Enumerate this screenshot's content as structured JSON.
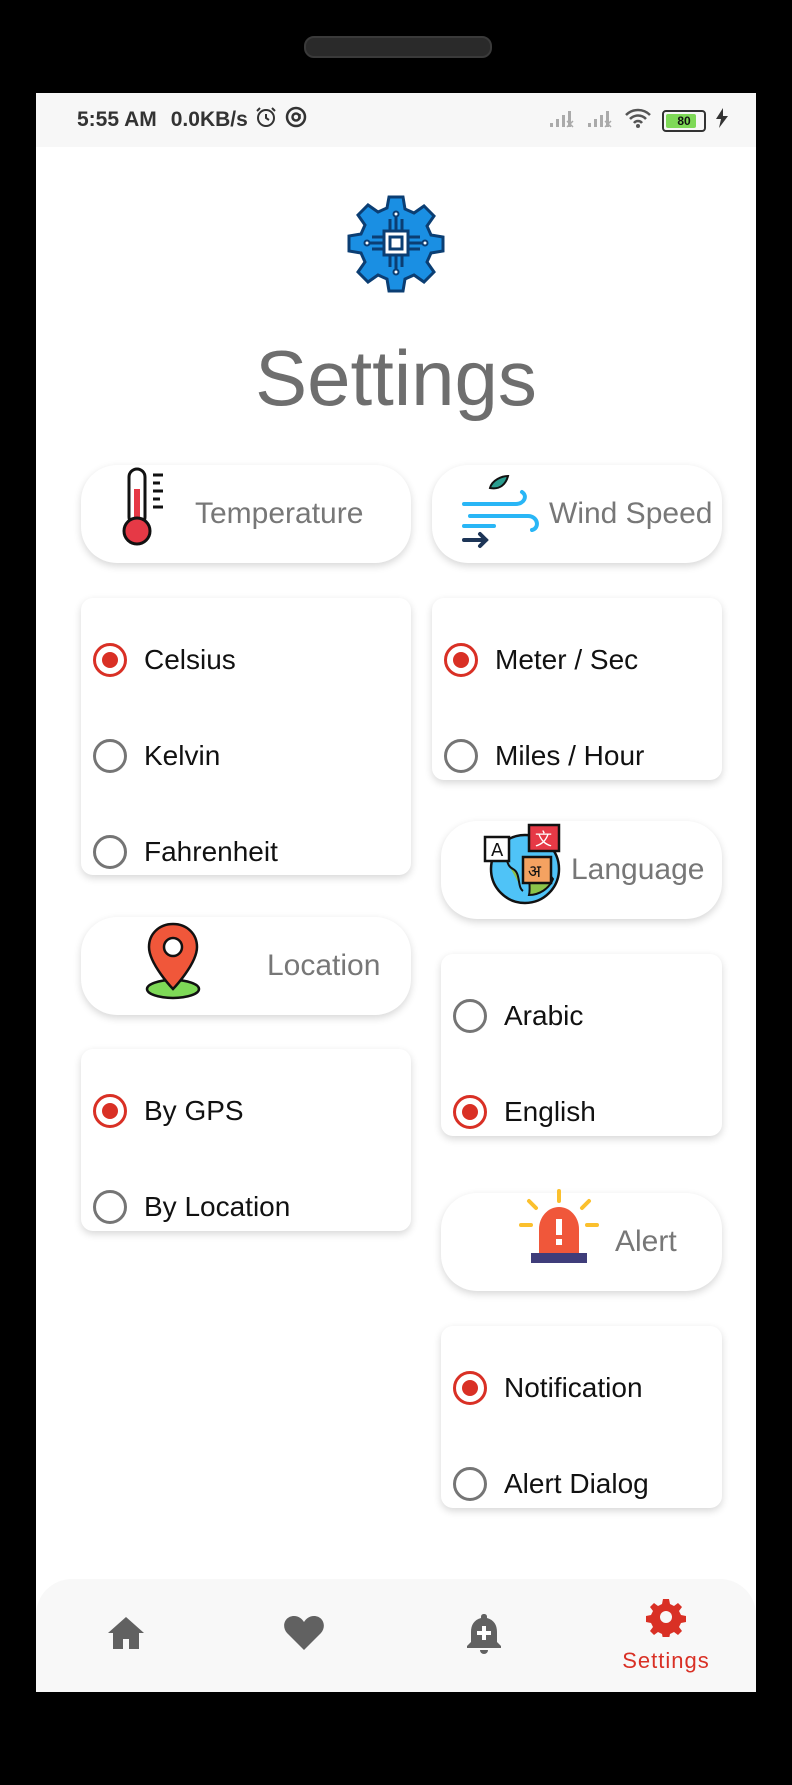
{
  "status_bar": {
    "time": "5:55 AM",
    "speed": "0.0KB/s",
    "battery": "80",
    "icons": [
      "alarm-icon",
      "at-sign-icon",
      "signal-icon",
      "signal-icon",
      "wifi-icon",
      "battery-icon",
      "charging-icon"
    ]
  },
  "page": {
    "title": "Settings",
    "logo_icon": "gear-chip-icon"
  },
  "sections": {
    "temperature": {
      "label": "Temperature",
      "icon": "thermometer-icon",
      "options": [
        "Celsius",
        "Kelvin",
        "Fahrenheit"
      ],
      "selected": "Celsius"
    },
    "wind_speed": {
      "label": "Wind Speed",
      "icon": "wind-icon",
      "options": [
        "Meter / Sec",
        "Miles / Hour"
      ],
      "selected": "Meter / Sec"
    },
    "language": {
      "label": "Language",
      "icon": "translate-globe-icon",
      "options": [
        "Arabic",
        "English"
      ],
      "selected": "English"
    },
    "location": {
      "label": "Location",
      "icon": "map-pin-icon",
      "options": [
        "By GPS",
        "By Location"
      ],
      "selected": "By GPS"
    },
    "alert": {
      "label": "Alert",
      "icon": "siren-icon",
      "options": [
        "Notification",
        "Alert Dialog"
      ],
      "selected": "Notification"
    }
  },
  "bottom_nav": {
    "items": [
      {
        "icon": "home-icon",
        "label": ""
      },
      {
        "icon": "heart-icon",
        "label": ""
      },
      {
        "icon": "add-alert-icon",
        "label": ""
      },
      {
        "icon": "gear-icon",
        "label": "Settings",
        "active": true
      }
    ]
  },
  "colors": {
    "accent": "#d93025",
    "inactive_nav": "#616161",
    "label_gray": "#777777"
  }
}
